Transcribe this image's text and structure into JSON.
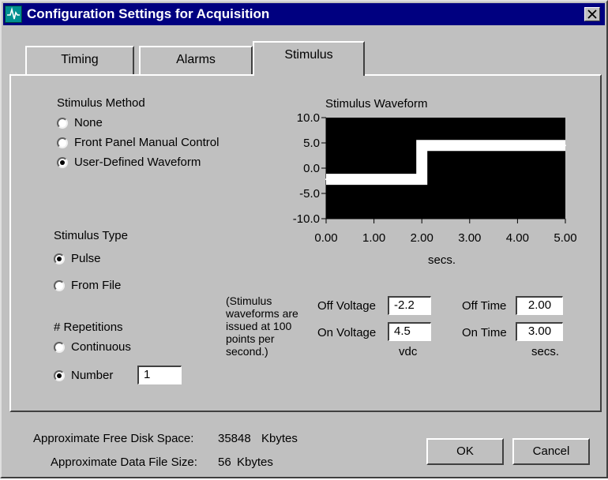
{
  "window": {
    "title": "Configuration Settings for Acquisition",
    "icon": "waveform-icon",
    "close_icon": "close-icon"
  },
  "tabs": [
    {
      "label": "Timing",
      "active": false
    },
    {
      "label": "Alarms",
      "active": false
    },
    {
      "label": "Stimulus",
      "active": true
    }
  ],
  "stimulus_method": {
    "heading": "Stimulus Method",
    "options": [
      {
        "label": "None",
        "selected": false
      },
      {
        "label": "Front Panel Manual Control",
        "selected": false
      },
      {
        "label": "User-Defined Waveform",
        "selected": true
      }
    ]
  },
  "stimulus_type": {
    "heading": "Stimulus Type",
    "options": [
      {
        "label": "Pulse",
        "selected": true
      },
      {
        "label": "From File",
        "selected": false
      }
    ]
  },
  "repetitions": {
    "heading": "# Repetitions",
    "options": [
      {
        "label": "Continuous",
        "selected": false
      },
      {
        "label": "Number",
        "selected": true
      }
    ],
    "number_value": "1"
  },
  "note": "(Stimulus waveforms are issued at 100 points per second.)",
  "voltage": {
    "off_label": "Off Voltage",
    "off_value": "-2.2",
    "on_label": "On Voltage",
    "on_value": "4.5",
    "unit": "vdc"
  },
  "time": {
    "off_label": "Off Time",
    "off_value": "2.00",
    "on_label": "On Time",
    "on_value": "3.00",
    "unit": "secs."
  },
  "chart_data": {
    "type": "line",
    "title": "Stimulus Waveform",
    "xlabel": "secs.",
    "ylabel": "",
    "xlim": [
      0,
      5
    ],
    "ylim": [
      -10,
      10
    ],
    "x_ticks": [
      "0.00",
      "1.00",
      "2.00",
      "3.00",
      "4.00",
      "5.00"
    ],
    "y_ticks": [
      "10.0",
      "5.0",
      "0.0",
      "-5.0",
      "-10.0"
    ],
    "series": [
      {
        "x": [
          0,
          2,
          2,
          5
        ],
        "y": [
          -2.2,
          -2.2,
          4.5,
          4.5
        ]
      }
    ],
    "background": "#000000",
    "line_color": "#ffffff"
  },
  "footer": {
    "disk_label": "Approximate Free Disk Space:",
    "disk_value": "35848",
    "disk_unit": "Kbytes",
    "file_label": "Approximate Data File Size:",
    "file_value": "56",
    "file_unit": "Kbytes"
  },
  "buttons": {
    "ok": "OK",
    "cancel": "Cancel"
  }
}
